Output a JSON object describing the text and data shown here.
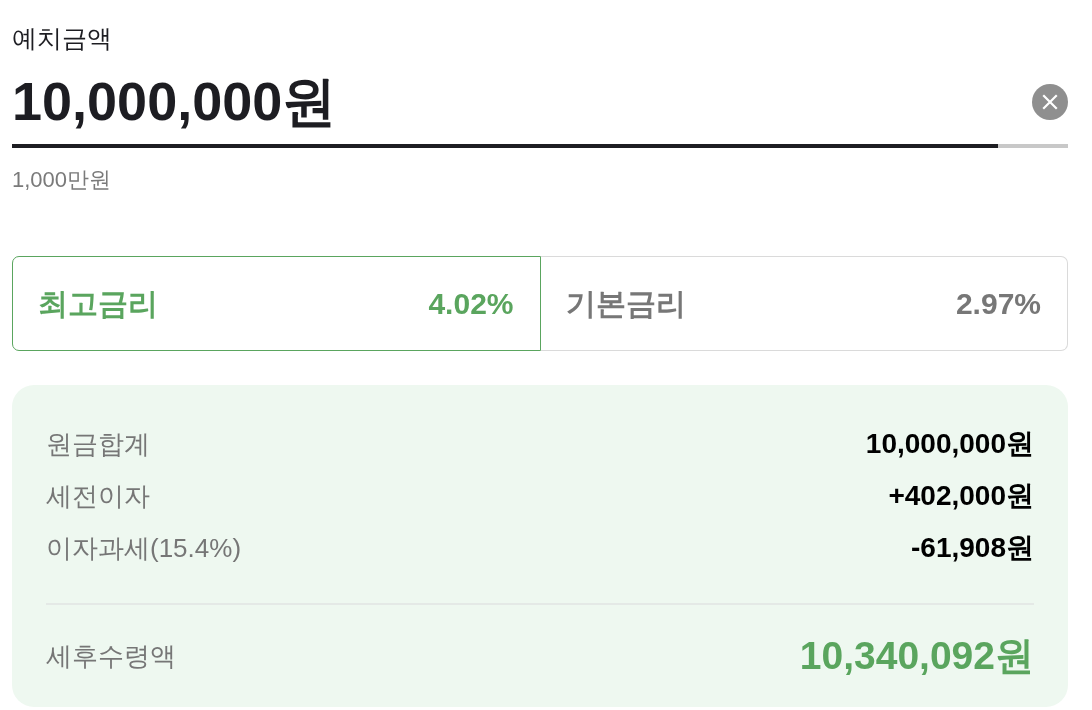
{
  "deposit": {
    "label": "예치금액",
    "value": "10,000,000원",
    "hint": "1,000만원"
  },
  "rate_tabs": [
    {
      "label": "최고금리",
      "rate": "4.02%",
      "selected": true
    },
    {
      "label": "기본금리",
      "rate": "2.97%",
      "selected": false
    }
  ],
  "summary": {
    "rows": [
      {
        "label": "원금합계",
        "value": "10,000,000원"
      },
      {
        "label": "세전이자",
        "value": "+402,000원"
      },
      {
        "label": "이자과세(15.4%)",
        "value": "-61,908원"
      }
    ],
    "total": {
      "label": "세후수령액",
      "value": "10,340,092원"
    }
  }
}
